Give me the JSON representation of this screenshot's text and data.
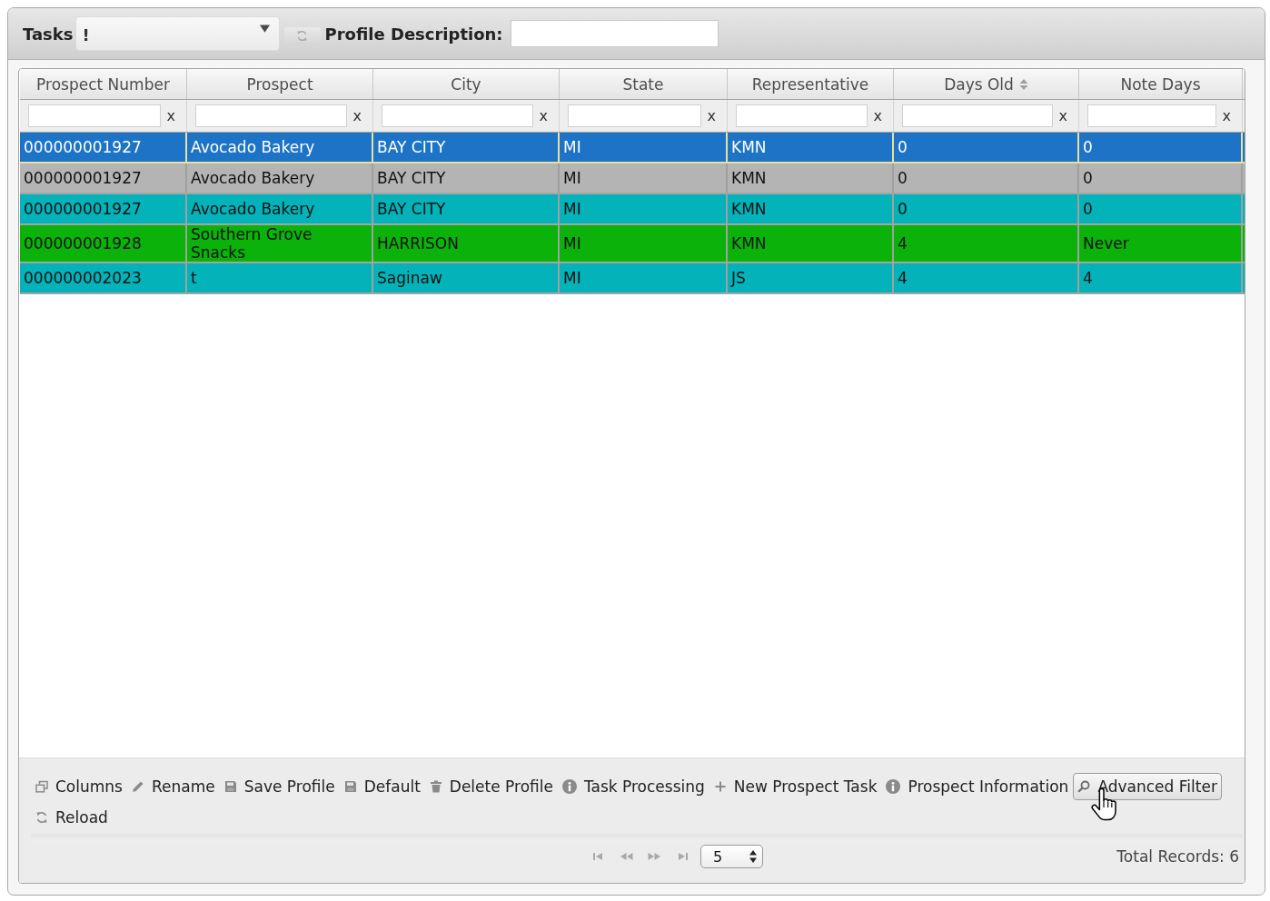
{
  "header": {
    "tasks_label": "Tasks",
    "tasks_select": {
      "value": "!"
    },
    "refresh_button": {
      "disabled": true
    },
    "profile_description_label": "Profile Description:"
  },
  "grid": {
    "columns": [
      {
        "label": "Prospect Number",
        "sortable": false,
        "filter_clear": "x"
      },
      {
        "label": "Prospect",
        "sortable": false,
        "filter_clear": "x"
      },
      {
        "label": "City",
        "sortable": false,
        "filter_clear": "x"
      },
      {
        "label": "State",
        "sortable": false,
        "filter_clear": "x"
      },
      {
        "label": "Representative",
        "sortable": false,
        "filter_clear": "x"
      },
      {
        "label": "Days Old",
        "sortable": true,
        "filter_clear": "x"
      },
      {
        "label": "Note Days",
        "sortable": false,
        "filter_clear": "x"
      }
    ],
    "rows": [
      {
        "selected": true,
        "color": "#1d74c6",
        "cells": [
          "000000001927",
          "Avocado Bakery",
          "BAY CITY",
          "MI",
          "KMN",
          "0",
          "0"
        ]
      },
      {
        "selected": false,
        "color": "#b4b4b4",
        "cells": [
          "000000001927",
          "Avocado Bakery",
          "BAY CITY",
          "MI",
          "KMN",
          "0",
          "0"
        ]
      },
      {
        "selected": false,
        "color": "#03b3b9",
        "cells": [
          "000000001927",
          "Avocado Bakery",
          "BAY CITY",
          "MI",
          "KMN",
          "0",
          "0"
        ]
      },
      {
        "selected": false,
        "color": "#0ab20a",
        "cells": [
          "000000001928",
          "Southern Grove Snacks",
          "HARRISON",
          "MI",
          "KMN",
          "4",
          "Never"
        ]
      },
      {
        "selected": false,
        "color": "#03b3b9",
        "cells": [
          "000000002023",
          "t",
          "Saginaw",
          "MI",
          "JS",
          "4",
          "4"
        ]
      }
    ]
  },
  "toolbar": [
    {
      "kind": "columns",
      "label": "Columns",
      "hovered": false
    },
    {
      "kind": "rename",
      "label": "Rename",
      "hovered": false
    },
    {
      "kind": "save",
      "label": "Save Profile",
      "hovered": false
    },
    {
      "kind": "save",
      "label": "Default",
      "hovered": false
    },
    {
      "kind": "delete",
      "label": "Delete Profile",
      "hovered": false
    },
    {
      "kind": "info",
      "label": "Task Processing",
      "hovered": false
    },
    {
      "kind": "add",
      "label": "New Prospect Task",
      "hovered": false
    },
    {
      "kind": "info",
      "label": "Prospect Information",
      "hovered": false
    },
    {
      "kind": "search",
      "label": "Advanced Filter",
      "hovered": true
    },
    {
      "kind": "reload",
      "label": "Reload",
      "hovered": false
    }
  ],
  "pager": {
    "page_size": "5",
    "total_records": "Total Records: 6"
  }
}
